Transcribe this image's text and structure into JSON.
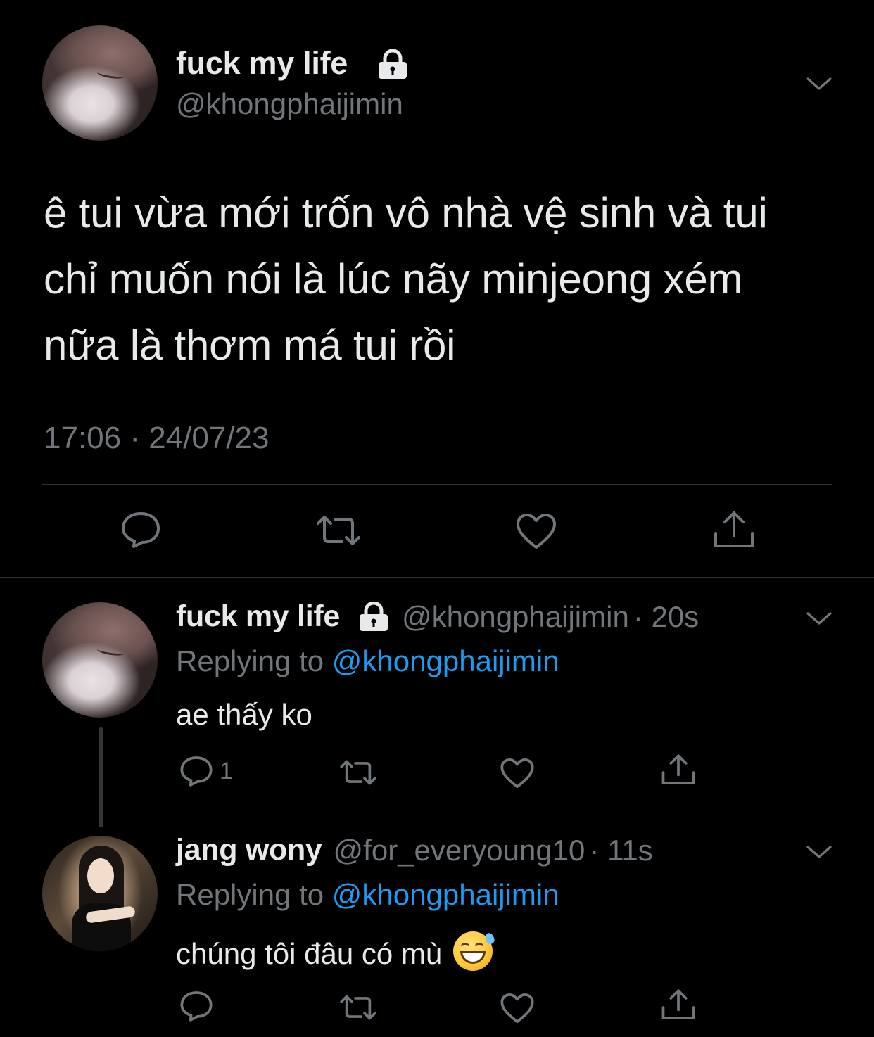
{
  "colors": {
    "background": "#000000",
    "primary_text": "#e7e9ea",
    "secondary_text": "#71767b",
    "mention": "#1d9bf0",
    "divider": "#2f3336"
  },
  "main_tweet": {
    "author_name": "fuck my life",
    "author_handle": "@khongphaijimin",
    "protected": true,
    "text": "ê tui vừa mới trốn vô nhà vệ sinh và tui\nchỉ muốn nói là lúc nãy minjeong xém\nnữa là thơm má tui rồi",
    "timestamp": "17:06 · 24/07/23",
    "actions": {
      "reply_icon": "reply-icon",
      "retweet_icon": "retweet-icon",
      "like_icon": "heart-icon",
      "share_icon": "share-icon"
    }
  },
  "replies": [
    {
      "author_name": "fuck my life",
      "protected": true,
      "author_handle": "@khongphaijimin",
      "age": "· 20s",
      "replying_prefix": "Replying to",
      "replying_to": "@khongphaijimin",
      "text": "ae thấy ko",
      "reply_count": "1"
    },
    {
      "author_name": "jang wony",
      "protected": false,
      "author_handle": "@for_everyoung10",
      "age": "· 11s",
      "replying_prefix": "Replying to",
      "replying_to": "@khongphaijimin",
      "text": "chúng tôi đâu có mù",
      "emoji": "grinning-face-with-sweat",
      "reply_count": ""
    }
  ]
}
